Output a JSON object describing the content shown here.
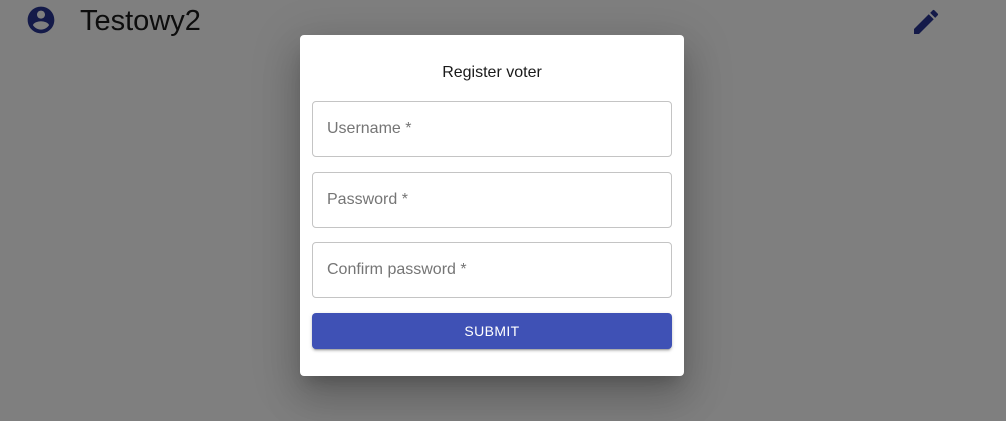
{
  "header": {
    "title": "Testowy2",
    "account_icon": "account-circle-icon",
    "edit_icon": "pencil-edit-icon"
  },
  "dialog": {
    "title": "Register voter",
    "fields": {
      "username": {
        "placeholder": "Username *",
        "value": ""
      },
      "password": {
        "placeholder": "Password *",
        "value": ""
      },
      "confirm_password": {
        "placeholder": "Confirm password *",
        "value": ""
      }
    },
    "submit_label": "SUBMIT"
  },
  "colors": {
    "primary": "#3f51b5",
    "backdrop": "rgba(0,0,0,0.5)"
  }
}
